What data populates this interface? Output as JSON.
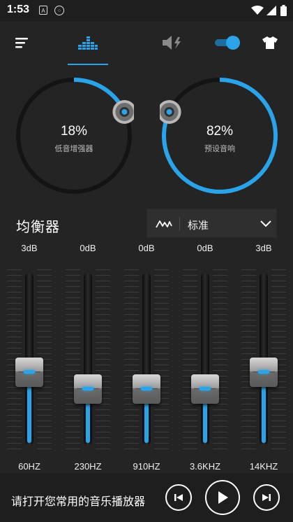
{
  "status_bar": {
    "time": "1:53",
    "icons": [
      "a-notification-icon",
      "grid-notification-icon",
      "wifi-icon",
      "signal-icon",
      "battery-icon"
    ]
  },
  "toolbar": {
    "icons": [
      "menu-icon",
      "equalizer-tab-icon",
      "volume-boost-icon",
      "toggle-switch",
      "shirt-theme-icon"
    ],
    "toggle_on": true,
    "accent": "#2aa3e9"
  },
  "knobs": [
    {
      "value": "18%",
      "label": "低音增强器",
      "level": 0.18
    },
    {
      "value": "82%",
      "label": "预设音响",
      "level": 0.82
    }
  ],
  "equalizer": {
    "title": "均衡器",
    "preset": "标准",
    "bands": [
      {
        "db": "3dB",
        "freq": "60HZ",
        "level": 0.38
      },
      {
        "db": "0dB",
        "freq": "230HZ",
        "level": 0.5
      },
      {
        "db": "0dB",
        "freq": "910HZ",
        "level": 0.5
      },
      {
        "db": "0dB",
        "freq": "3.6KHZ",
        "level": 0.5
      },
      {
        "db": "3dB",
        "freq": "14KHZ",
        "level": 0.38
      }
    ]
  },
  "player": {
    "prompt": "请打开您常用的音乐播放器"
  }
}
